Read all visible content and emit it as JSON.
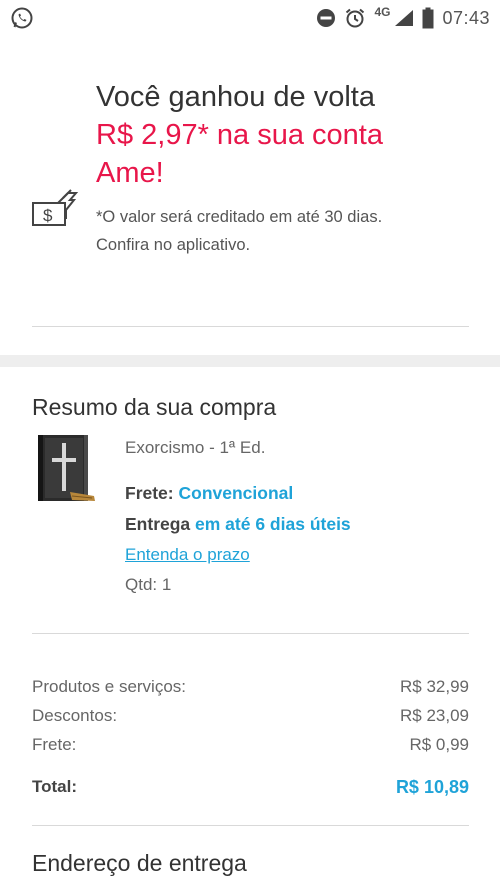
{
  "status_bar": {
    "network": "4G",
    "time": "07:43",
    "icons": [
      "whatsapp-icon",
      "do-not-disturb-icon",
      "alarm-icon",
      "signal-icon",
      "battery-icon"
    ]
  },
  "cashback": {
    "line1": "Você ganhou de volta",
    "line2": "R$ 2,97* na sua conta",
    "line3": "Ame!",
    "note_line1": "*O valor será creditado em até 30 dias.",
    "note_line2": "Confira no aplicativo.",
    "icon": "money-hand-icon",
    "accent_color": "#e8164a"
  },
  "summary": {
    "title": "Resumo da sua compra",
    "product_name": "Exorcismo - 1ª Ed.",
    "freight_label": "Frete:",
    "freight_value": "Convencional",
    "delivery_label": "Entrega",
    "delivery_value": "em até 6 dias úteis",
    "deadline_link": "Entenda o prazo",
    "quantity": "Qtd: 1",
    "link_color": "#1fa3d8"
  },
  "totals": {
    "products_label": "Produtos e serviços:",
    "products_value": "R$ 32,99",
    "discounts_label": "Descontos:",
    "discounts_value": "R$ 23,09",
    "shipping_label": "Frete:",
    "shipping_value": "R$ 0,99",
    "total_label": "Total:",
    "total_value": "R$ 10,89"
  },
  "address": {
    "title": "Endereço de entrega"
  }
}
